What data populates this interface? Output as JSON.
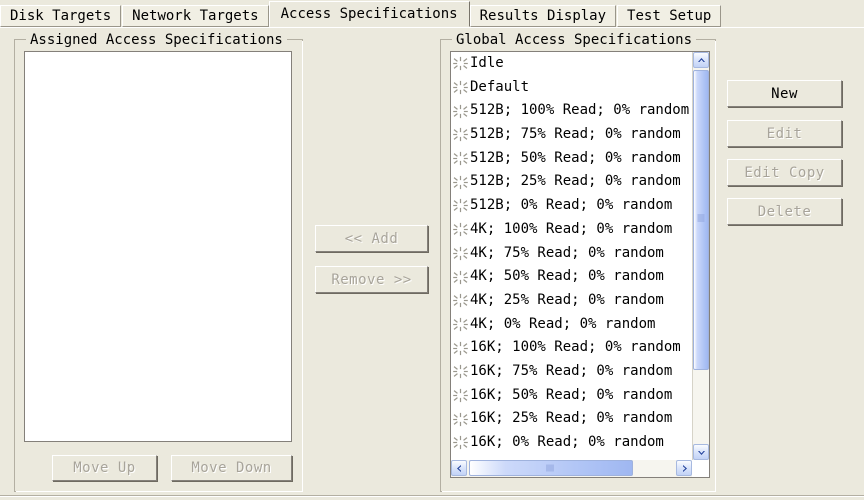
{
  "window": {
    "app": "Iometer",
    "bg_color": "#ebe9dd",
    "list_bg_color": "#ffffff",
    "scrollbar_accent": "#aec3f5",
    "disabled_text_color": "#a8a49a"
  },
  "tabs": [
    {
      "label": "Disk Targets",
      "active": false
    },
    {
      "label": "Network Targets",
      "active": false
    },
    {
      "label": "Access Specifications",
      "active": true
    },
    {
      "label": "Results Display",
      "active": false
    },
    {
      "label": "Test Setup",
      "active": false
    }
  ],
  "assigned_panel": {
    "title": "Assigned Access Specifications",
    "items": [],
    "buttons": [
      {
        "label": "Move Up",
        "enabled": false
      },
      {
        "label": "Move Down",
        "enabled": false
      }
    ]
  },
  "transfer_buttons": [
    {
      "label": "<< Add",
      "enabled": false
    },
    {
      "label": "Remove >>",
      "enabled": false
    }
  ],
  "global_panel": {
    "title": "Global Access Specifications",
    "icon_name": "access-spec-icon",
    "items": [
      {
        "label": "Idle"
      },
      {
        "label": "Default"
      },
      {
        "label": "512B; 100% Read; 0% random"
      },
      {
        "label": "512B; 75% Read; 0% random"
      },
      {
        "label": "512B; 50% Read; 0% random"
      },
      {
        "label": "512B; 25% Read; 0% random"
      },
      {
        "label": "512B; 0% Read; 0% random"
      },
      {
        "label": "4K; 100% Read; 0% random"
      },
      {
        "label": "4K; 75% Read; 0% random"
      },
      {
        "label": "4K; 50% Read; 0% random"
      },
      {
        "label": "4K; 25% Read; 0% random"
      },
      {
        "label": "4K; 0% Read; 0% random"
      },
      {
        "label": "16K; 100% Read; 0% random"
      },
      {
        "label": "16K; 75% Read; 0% random"
      },
      {
        "label": "16K; 50% Read; 0% random"
      },
      {
        "label": "16K; 25% Read; 0% random"
      },
      {
        "label": "16K; 0% Read; 0% random"
      }
    ],
    "buttons": [
      {
        "label": "New",
        "enabled": true
      },
      {
        "label": "Edit",
        "enabled": false
      },
      {
        "label": "Edit Copy",
        "enabled": false
      },
      {
        "label": "Delete",
        "enabled": false
      }
    ],
    "vscroll": {
      "up_icon": "chevron-up-icon",
      "down_icon": "chevron-down-icon"
    },
    "hscroll": {
      "left_icon": "chevron-left-icon",
      "right_icon": "chevron-right-icon"
    }
  }
}
